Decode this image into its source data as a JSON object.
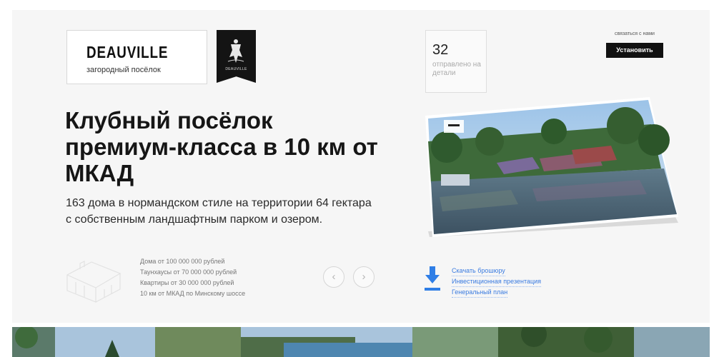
{
  "brand": {
    "name": "DEAUVILLE",
    "subtitle": "загородный посёлок",
    "emblem_caption": "DEAUVILLE"
  },
  "hero": {
    "headline": "Клубный посёлок премиум-класса в 10 км от МКАД",
    "description": "163 дома в нормандском стиле на территории 64 гектара с собственным ландшафтным парком и озером."
  },
  "facts": [
    "Дома от 100 000 000 рублей",
    "Таунхаусы от 70 000 000 рублей",
    "Квартиры от 30 000 000 рублей",
    "10 км от МКАД по Минскому шоссе"
  ],
  "carousel": {
    "prev_label": "‹",
    "next_label": "›"
  },
  "stat": {
    "value": "32",
    "label": "отправлено на детали"
  },
  "contact": {
    "caption": "связаться с нами",
    "button_label": "Установить"
  },
  "downloads": [
    "Скачать брошюру",
    "Инвестиционная презентация",
    "Генеральный план"
  ],
  "colors": {
    "accent_blue": "#2f7ee6",
    "dark": "#111111",
    "panel": "#f6f6f6"
  },
  "icons": {
    "download": "download-arrow-icon",
    "house": "house-sketch-icon",
    "emblem": "crest-emblem-icon"
  }
}
